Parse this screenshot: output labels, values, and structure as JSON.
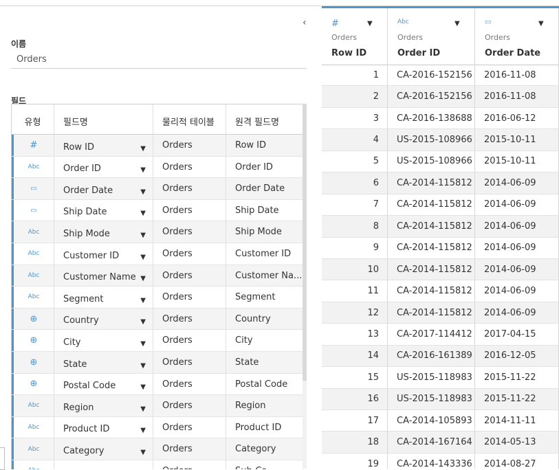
{
  "left_panel": {
    "name_label": "이름",
    "name_value": "Orders",
    "fields_label": "필드",
    "collapse_icon": "‹",
    "columns": [
      "유형",
      "필드명",
      "물리적 테이블",
      "원격 필드명"
    ],
    "fields": [
      {
        "type": "number",
        "icon": "#",
        "name": "Row ID",
        "table": "Orders",
        "remote": "Row ID"
      },
      {
        "type": "string",
        "icon": "Abc",
        "name": "Order ID",
        "table": "Orders",
        "remote": "Order ID"
      },
      {
        "type": "date",
        "icon": "📅",
        "name": "Order Date",
        "table": "Orders",
        "remote": "Order Date"
      },
      {
        "type": "date",
        "icon": "📅",
        "name": "Ship Date",
        "table": "Orders",
        "remote": "Ship Date"
      },
      {
        "type": "string",
        "icon": "Abc",
        "name": "Ship Mode",
        "table": "Orders",
        "remote": "Ship Mode"
      },
      {
        "type": "string",
        "icon": "Abc",
        "name": "Customer ID",
        "table": "Orders",
        "remote": "Customer ID"
      },
      {
        "type": "string",
        "icon": "Abc",
        "name": "Customer Name",
        "table": "Orders",
        "remote": "Customer Na..."
      },
      {
        "type": "string",
        "icon": "Abc",
        "name": "Segment",
        "table": "Orders",
        "remote": "Segment"
      },
      {
        "type": "geo",
        "icon": "🌐",
        "name": "Country",
        "table": "Orders",
        "remote": "Country"
      },
      {
        "type": "geo",
        "icon": "🌐",
        "name": "City",
        "table": "Orders",
        "remote": "City"
      },
      {
        "type": "geo",
        "icon": "🌐",
        "name": "State",
        "table": "Orders",
        "remote": "State"
      },
      {
        "type": "geo",
        "icon": "🌐",
        "name": "Postal Code",
        "table": "Orders",
        "remote": "Postal Code"
      },
      {
        "type": "string",
        "icon": "Abc",
        "name": "Region",
        "table": "Orders",
        "remote": "Region"
      },
      {
        "type": "string",
        "icon": "Abc",
        "name": "Product ID",
        "table": "Orders",
        "remote": "Product ID"
      },
      {
        "type": "string",
        "icon": "Abc",
        "name": "Category",
        "table": "Orders",
        "remote": "Category"
      },
      {
        "type": "string",
        "icon": "Abc",
        "name": "",
        "table": "Orders",
        "remote": "Sub-Ca..."
      }
    ]
  },
  "data_grid": {
    "columns": [
      {
        "icon": "#",
        "source": "Orders",
        "name": "Row ID"
      },
      {
        "icon": "Abc",
        "source": "Orders",
        "name": "Order ID"
      },
      {
        "icon": "📅",
        "source": "Orders",
        "name": "Order Date"
      }
    ],
    "rows": [
      [
        "1",
        "CA-2016-152156",
        "2016-11-08"
      ],
      [
        "2",
        "CA-2016-152156",
        "2016-11-08"
      ],
      [
        "3",
        "CA-2016-138688",
        "2016-06-12"
      ],
      [
        "4",
        "US-2015-108966",
        "2015-10-11"
      ],
      [
        "5",
        "US-2015-108966",
        "2015-10-11"
      ],
      [
        "6",
        "CA-2014-115812",
        "2014-06-09"
      ],
      [
        "7",
        "CA-2014-115812",
        "2014-06-09"
      ],
      [
        "8",
        "CA-2014-115812",
        "2014-06-09"
      ],
      [
        "9",
        "CA-2014-115812",
        "2014-06-09"
      ],
      [
        "10",
        "CA-2014-115812",
        "2014-06-09"
      ],
      [
        "11",
        "CA-2014-115812",
        "2014-06-09"
      ],
      [
        "12",
        "CA-2014-115812",
        "2014-06-09"
      ],
      [
        "13",
        "CA-2017-114412",
        "2017-04-15"
      ],
      [
        "14",
        "CA-2016-161389",
        "2016-12-05"
      ],
      [
        "15",
        "US-2015-118983",
        "2015-11-22"
      ],
      [
        "16",
        "US-2015-118983",
        "2015-11-22"
      ],
      [
        "17",
        "CA-2014-105893",
        "2014-11-11"
      ],
      [
        "18",
        "CA-2014-167164",
        "2014-05-13"
      ],
      [
        "19",
        "CA-2014-143336",
        "2014-08-27"
      ]
    ]
  },
  "colors": {
    "accent": "#4a96d1",
    "alt_row": "#f2f2f2",
    "border": "#d6d6d6"
  }
}
